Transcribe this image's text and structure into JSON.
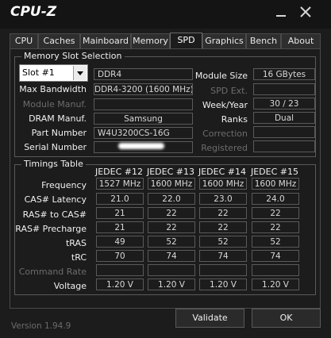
{
  "window": {
    "title": "CPU-Z"
  },
  "tabs": [
    "CPU",
    "Caches",
    "Mainboard",
    "Memory",
    "SPD",
    "Graphics",
    "Bench",
    "About"
  ],
  "active_tab": "SPD",
  "slot_selection": {
    "title": "Memory Slot Selection",
    "selected_slot": "Slot #1",
    "type": "DDR4",
    "max_bandwidth_label": "Max Bandwidth",
    "max_bandwidth": "DDR4-3200 (1600 MHz)",
    "module_manuf_label": "Module Manuf.",
    "module_manuf": "",
    "dram_manuf_label": "DRAM Manuf.",
    "dram_manuf": "Samsung",
    "part_number_label": "Part Number",
    "part_number": "W4U3200CS-16G",
    "serial_number_label": "Serial Number",
    "module_size_label": "Module Size",
    "module_size": "16 GBytes",
    "spd_ext_label": "SPD Ext.",
    "spd_ext": "",
    "week_year_label": "Week/Year",
    "week_year": "30 / 23",
    "ranks_label": "Ranks",
    "ranks": "Dual",
    "correction_label": "Correction",
    "correction": "",
    "registered_label": "Registered",
    "registered": ""
  },
  "timings": {
    "title": "Timings Table",
    "columns": [
      "JEDEC #12",
      "JEDEC #13",
      "JEDEC #14",
      "JEDEC #15"
    ],
    "rows": [
      {
        "label": "Frequency",
        "values": [
          "1527 MHz",
          "1600 MHz",
          "1600 MHz",
          "1600 MHz"
        ]
      },
      {
        "label": "CAS# Latency",
        "values": [
          "21.0",
          "22.0",
          "23.0",
          "24.0"
        ]
      },
      {
        "label": "RAS# to CAS#",
        "values": [
          "21",
          "22",
          "22",
          "22"
        ]
      },
      {
        "label": "RAS# Precharge",
        "values": [
          "21",
          "22",
          "22",
          "22"
        ]
      },
      {
        "label": "tRAS",
        "values": [
          "49",
          "52",
          "52",
          "52"
        ]
      },
      {
        "label": "tRC",
        "values": [
          "70",
          "74",
          "74",
          "74"
        ]
      },
      {
        "label": "Command Rate",
        "values": [
          "",
          "",
          "",
          ""
        ]
      },
      {
        "label": "Voltage",
        "values": [
          "1.20 V",
          "1.20 V",
          "1.20 V",
          "1.20 V"
        ]
      }
    ]
  },
  "footer": {
    "version": "Version 1.94.9",
    "validate_label": "Validate",
    "ok_label": "OK"
  }
}
